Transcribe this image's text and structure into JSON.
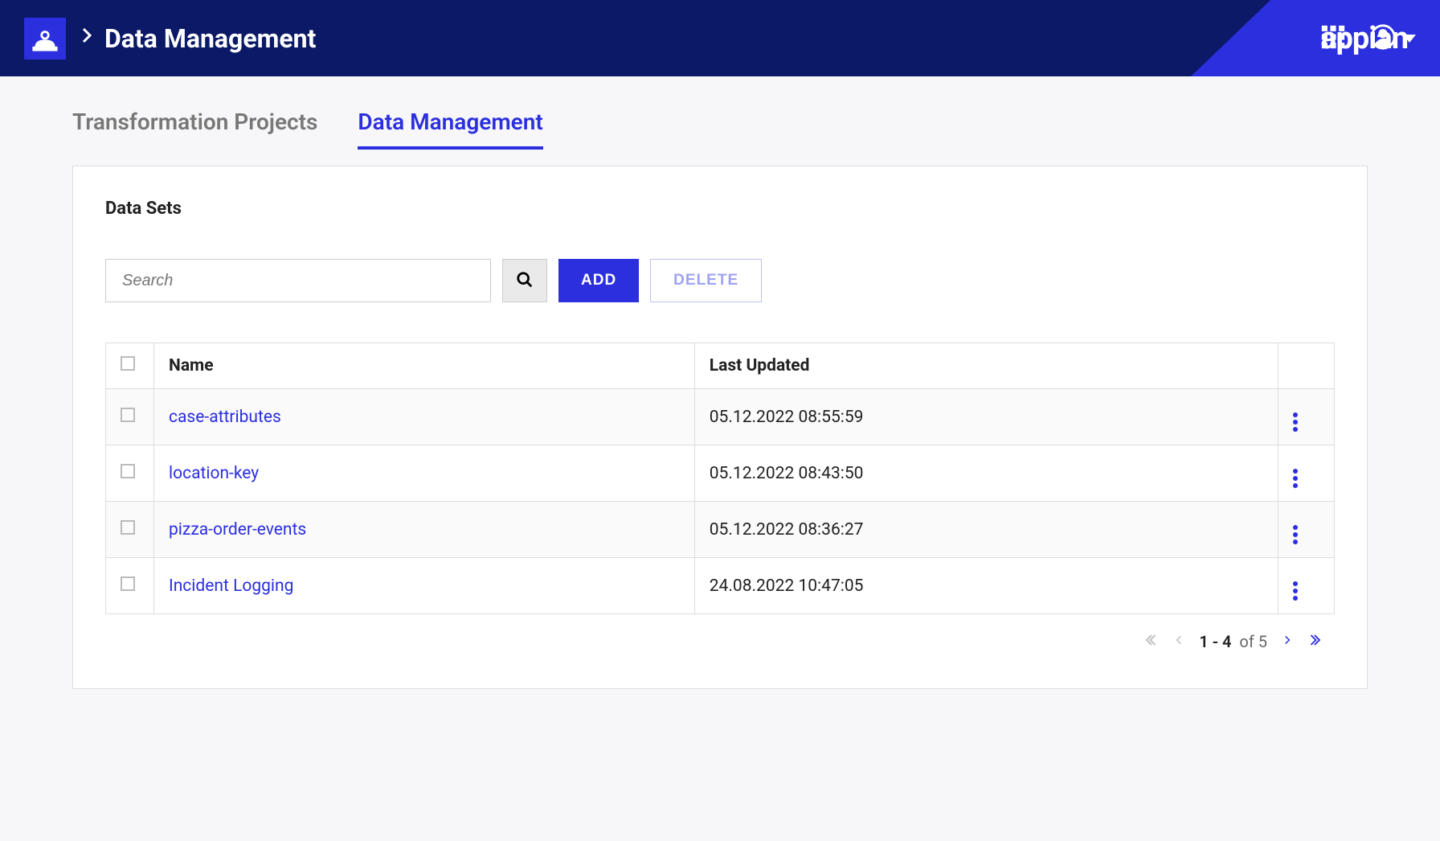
{
  "header": {
    "title": "Data Management",
    "brand": "appian"
  },
  "tabs": [
    {
      "label": "Transformation Projects",
      "active": false
    },
    {
      "label": "Data Management",
      "active": true
    }
  ],
  "panel": {
    "title": "Data Sets",
    "search_placeholder": "Search",
    "add_label": "ADD",
    "delete_label": "DELETE"
  },
  "table": {
    "columns": {
      "name": "Name",
      "updated": "Last Updated"
    },
    "rows": [
      {
        "name": "case-attributes",
        "updated": "05.12.2022 08:55:59"
      },
      {
        "name": "location-key",
        "updated": "05.12.2022 08:43:50"
      },
      {
        "name": "pizza-order-events",
        "updated": "05.12.2022 08:36:27"
      },
      {
        "name": "Incident Logging",
        "updated": "24.08.2022 10:47:05"
      }
    ]
  },
  "pagination": {
    "range": "1 - 4",
    "of_label": "of",
    "total": "5"
  }
}
